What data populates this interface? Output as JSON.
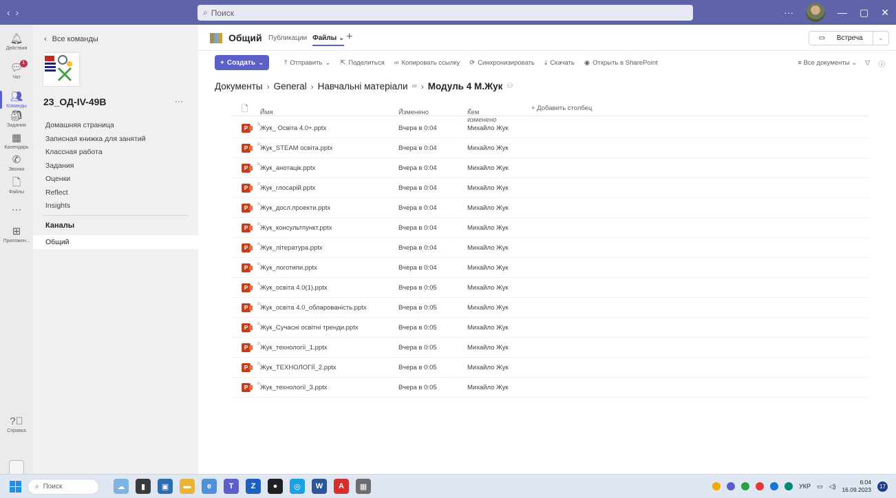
{
  "window": {
    "search_placeholder": "Поиск"
  },
  "rail": {
    "items": [
      {
        "label": "Действия",
        "icon": "bell-icon"
      },
      {
        "label": "Чат",
        "icon": "chat-icon",
        "badge": "1"
      },
      {
        "label": "Команды",
        "icon": "teams-icon"
      },
      {
        "label": "Задания",
        "icon": "assignments-icon"
      },
      {
        "label": "Календарь",
        "icon": "calendar-icon"
      },
      {
        "label": "Звонки",
        "icon": "phone-icon"
      },
      {
        "label": "Файлы",
        "icon": "file-icon"
      },
      {
        "label": "Приложен...",
        "icon": "apps-icon"
      },
      {
        "label": "Справка",
        "icon": "help-icon"
      }
    ]
  },
  "sidebar": {
    "back_label": "Все команды",
    "team_name": "23_ОД-IV-49В",
    "nav": [
      "Домашняя страница",
      "Записная книжка для занятий",
      "Классная работа",
      "Задания",
      "Оценки",
      "Reflect",
      "Insights"
    ],
    "channels_heading": "Каналы",
    "channels": [
      "Общий"
    ]
  },
  "channel": {
    "title": "Общий",
    "tabs": [
      "Публикации",
      "Файлы"
    ],
    "active_tab": "Файлы",
    "meet_label": "Встреча"
  },
  "toolbar": {
    "create_label": "Создать",
    "actions": [
      "Отправить",
      "Поделиться",
      "Копировать ссылку",
      "Синхронизировать",
      "Скачать",
      "Открыть в SharePoint"
    ],
    "view_label": "Все документы"
  },
  "breadcrumb": {
    "parts": [
      "Документы",
      "General",
      "Навчальні матеріали",
      "Модуль 4 М.Жук"
    ]
  },
  "files": {
    "columns": {
      "name": "Имя",
      "modified": "Изменено",
      "modified_by": "Кем изменено",
      "add_column": "+ Добавить столбец"
    },
    "rows": [
      {
        "name": "Жук_ Освіта 4.0+.pptx",
        "modified": "Вчера в 0:04",
        "by": "Михайло Жук"
      },
      {
        "name": "Жук_STEAM освіта.pptx",
        "modified": "Вчера в 0:04",
        "by": "Михайло Жук"
      },
      {
        "name": "Жук_анотацік.pptx",
        "modified": "Вчера в 0:04",
        "by": "Михайло Жук"
      },
      {
        "name": "Жук_глосарій.pptx",
        "modified": "Вчера в 0:04",
        "by": "Михайло Жук"
      },
      {
        "name": "Жук_досл.проекти.pptx",
        "modified": "Вчера в 0:04",
        "by": "Михайло Жук"
      },
      {
        "name": "Жук_консультпункт.pptx",
        "modified": "Вчера в 0:04",
        "by": "Михайло Жук"
      },
      {
        "name": "Жук_література.pptx",
        "modified": "Вчера в 0:04",
        "by": "Михайло Жук"
      },
      {
        "name": "Жук_логотипи.pptx",
        "modified": "Вчера в 0:04",
        "by": "Михайло Жук"
      },
      {
        "name": "Жук_освіта 4.0(1).pptx",
        "modified": "Вчера в 0:05",
        "by": "Михайло Жук"
      },
      {
        "name": "Жук_освіта 4.0_обларованість.pptx",
        "modified": "Вчера в 0:05",
        "by": "Михайло Жук"
      },
      {
        "name": "Жук_Сучасні освітні тренди.pptx",
        "modified": "Вчера в 0:05",
        "by": "Михайло Жук"
      },
      {
        "name": "Жук_технології_1.pptx",
        "modified": "Вчера в 0:05",
        "by": "Михайло Жук"
      },
      {
        "name": "Жук_ТЕХНОЛОГІЇ_2.pptx",
        "modified": "Вчера в 0:05",
        "by": "Михайло Жук"
      },
      {
        "name": "Жук_технології_3.pptx",
        "modified": "Вчера в 0:05",
        "by": "Михайло Жук"
      }
    ]
  },
  "taskbar": {
    "search_label": "Поиск",
    "lang": "УКР",
    "time": "6:04",
    "date": "16.09.2023",
    "notification_count": "17"
  },
  "colors": {
    "titlebar": "#5f63a8",
    "accent": "#5b5fc7",
    "powerpoint": "#c43e1c"
  }
}
